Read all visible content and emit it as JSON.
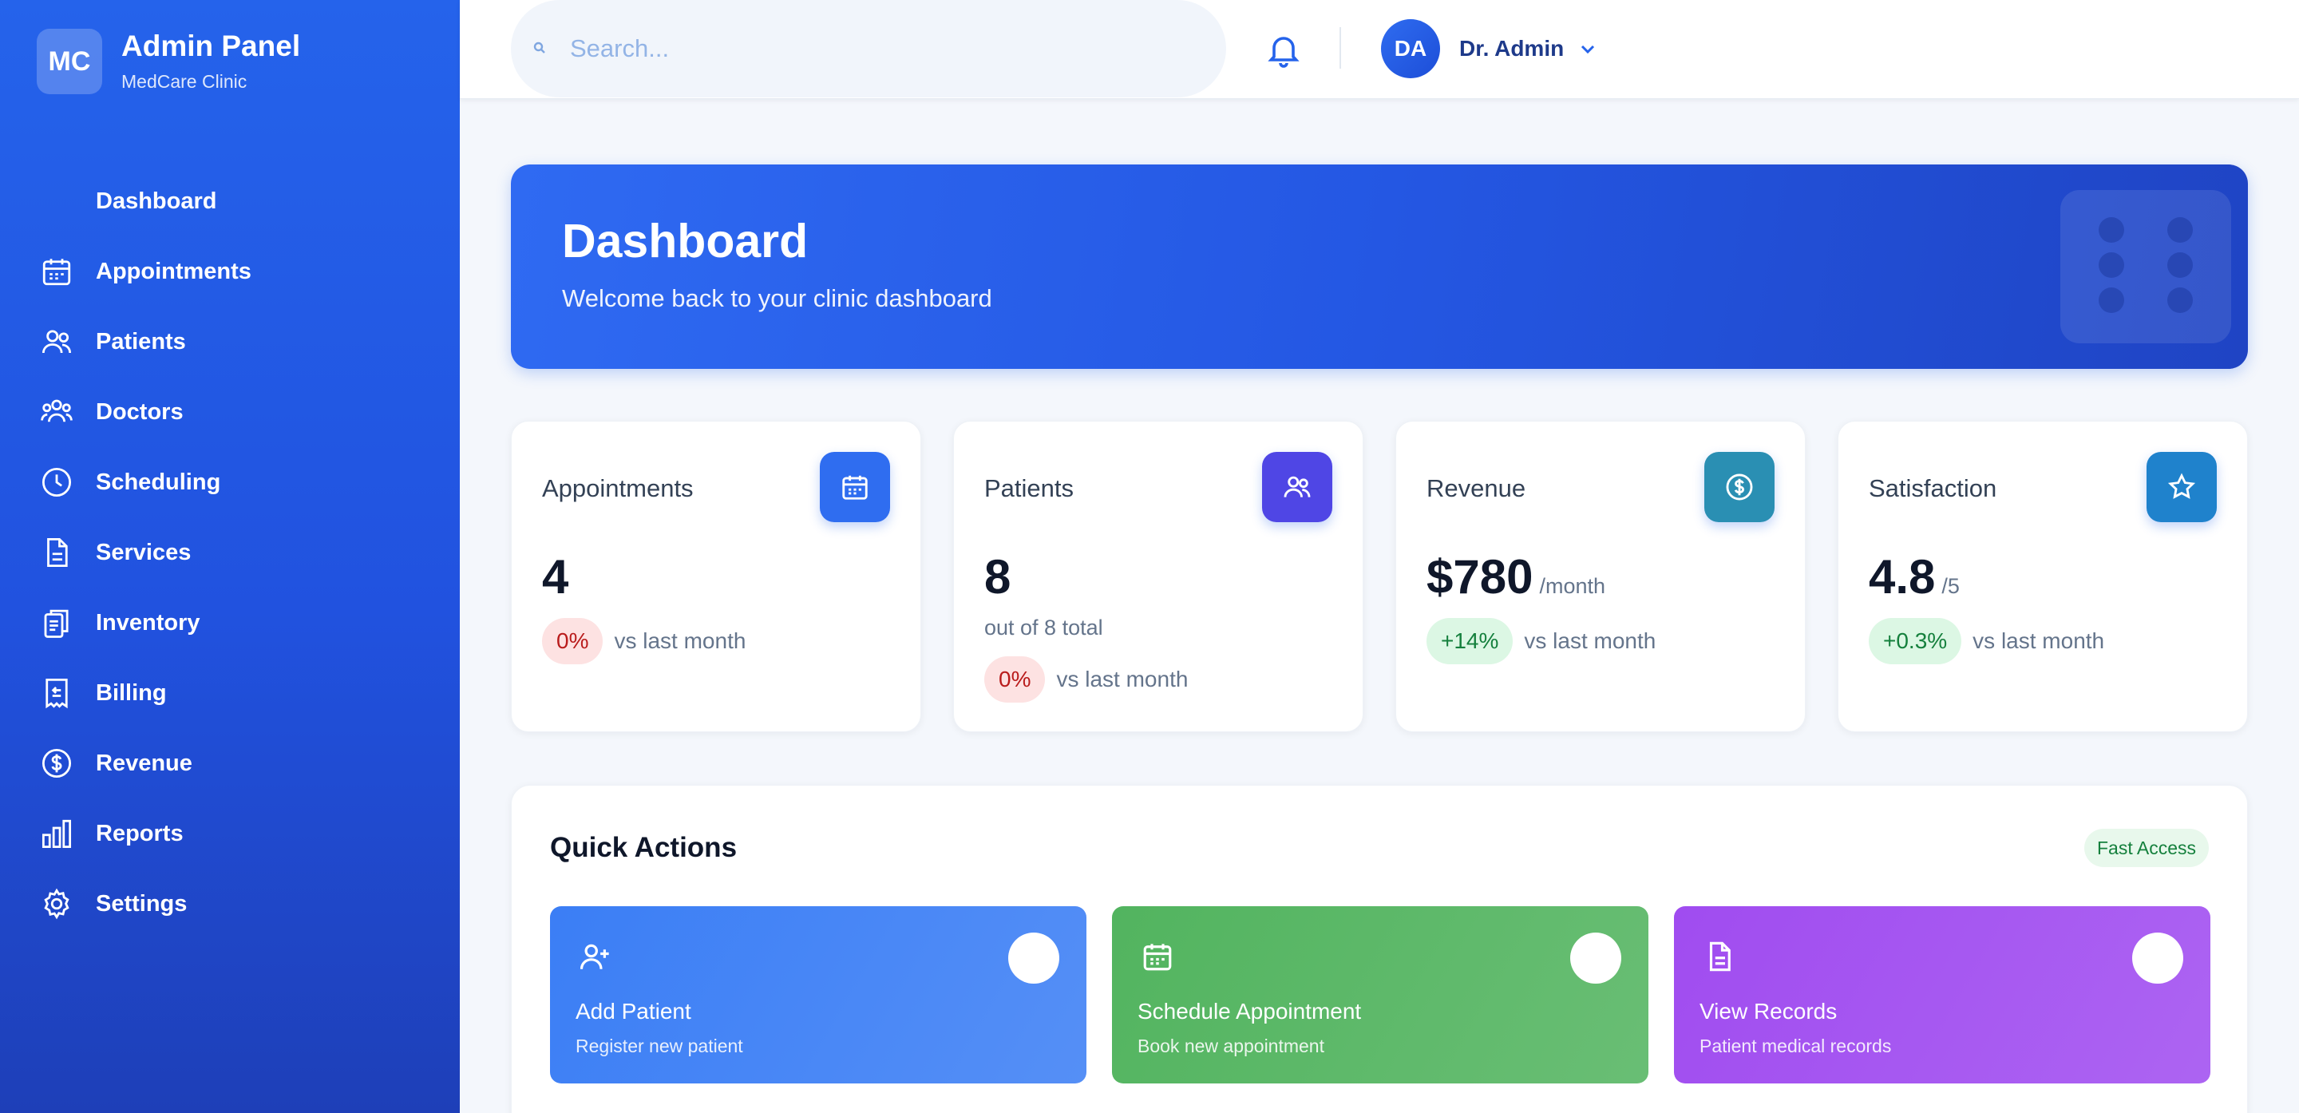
{
  "brand": {
    "logo": "MC",
    "title": "Admin Panel",
    "subtitle": "MedCare Clinic"
  },
  "sidebar": {
    "items": [
      {
        "label": "Dashboard",
        "icon": "none"
      },
      {
        "label": "Appointments",
        "icon": "calendar-icon"
      },
      {
        "label": "Patients",
        "icon": "users-icon"
      },
      {
        "label": "Doctors",
        "icon": "user-group-icon"
      },
      {
        "label": "Scheduling",
        "icon": "clock-icon"
      },
      {
        "label": "Services",
        "icon": "document-icon"
      },
      {
        "label": "Inventory",
        "icon": "clipboard-icon"
      },
      {
        "label": "Billing",
        "icon": "receipt-icon"
      },
      {
        "label": "Revenue",
        "icon": "dollar-icon"
      },
      {
        "label": "Reports",
        "icon": "bar-chart-icon"
      },
      {
        "label": "Settings",
        "icon": "gear-icon"
      }
    ]
  },
  "topbar": {
    "search_placeholder": "Search...",
    "user_initials": "DA",
    "user_name": "Dr. Admin"
  },
  "hero": {
    "title": "Dashboard",
    "subtitle": "Welcome back to your clinic dashboard"
  },
  "stats": [
    {
      "title": "Appointments",
      "value": "4",
      "unit": "",
      "note": "",
      "change": "0%",
      "change_type": "neutral",
      "vs": "vs last month",
      "icon": "calendar-icon",
      "color": "#2f6df0"
    },
    {
      "title": "Patients",
      "value": "8",
      "unit": "",
      "note": "out of 8 total",
      "change": "0%",
      "change_type": "neutral",
      "vs": "vs last month",
      "icon": "users-icon",
      "color": "#4f46e5"
    },
    {
      "title": "Revenue",
      "value": "$780",
      "unit": "/month",
      "note": "",
      "change": "+14%",
      "change_type": "positive",
      "vs": "vs last month",
      "icon": "dollar-icon",
      "color": "#2a8fb3"
    },
    {
      "title": "Satisfaction",
      "value": "4.8",
      "unit": "/5",
      "note": "",
      "change": "+0.3%",
      "change_type": "positive",
      "vs": "vs last month",
      "icon": "star-icon",
      "color": "#1f82cc"
    }
  ],
  "quick_actions": {
    "title": "Quick Actions",
    "badge": "Fast Access",
    "items": [
      {
        "title": "Add Patient",
        "subtitle": "Register new patient",
        "icon": "user-plus-icon",
        "color": "#3b7ef5"
      },
      {
        "title": "Schedule Appointment",
        "subtitle": "Book new appointment",
        "icon": "calendar-icon",
        "color": "#52b45f"
      },
      {
        "title": "View Records",
        "subtitle": "Patient medical records",
        "icon": "file-icon",
        "color": "#a04cf0"
      }
    ]
  }
}
